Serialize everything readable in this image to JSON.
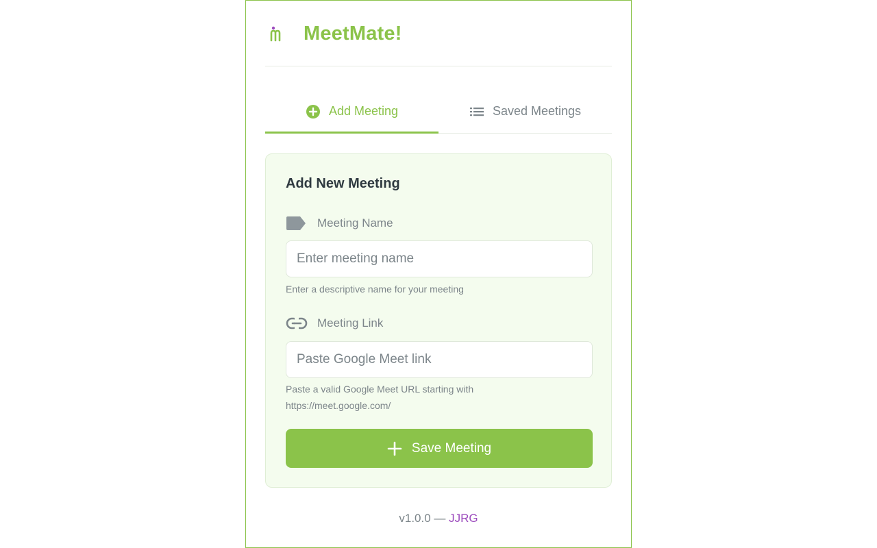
{
  "app": {
    "title": "MeetMate!",
    "logo_icon": "meetmate-logo-icon",
    "accent_color": "#8bc34a"
  },
  "tabs": [
    {
      "label": "Add Meeting",
      "icon": "plus-circle-icon",
      "active": true
    },
    {
      "label": "Saved Meetings",
      "icon": "list-icon",
      "active": false
    }
  ],
  "form": {
    "title": "Add New Meeting",
    "name_field": {
      "label": "Meeting Name",
      "icon": "tag-icon",
      "placeholder": "Enter meeting name",
      "value": "",
      "hint": "Enter a descriptive name for your meeting"
    },
    "link_field": {
      "label": "Meeting Link",
      "icon": "link-icon",
      "placeholder": "Paste Google Meet link",
      "value": "",
      "hint": "Paste a valid Google Meet URL starting with https://meet.google.com/"
    },
    "save_label": "Save Meeting",
    "save_icon": "plus-icon"
  },
  "footer": {
    "version": "v1.0.0",
    "separator": "—",
    "author": "JJRG",
    "author_color": "#9c4bbd"
  }
}
